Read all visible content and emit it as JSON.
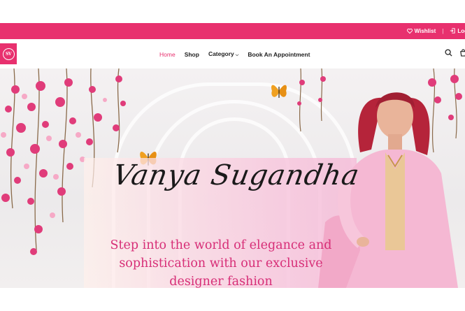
{
  "topbar": {
    "wishlist_label": "Wishlist",
    "login_label": "Log"
  },
  "header": {
    "logo_text": "SV",
    "nav": [
      {
        "label": "Home",
        "active": true
      },
      {
        "label": "Shop",
        "active": false
      },
      {
        "label": "Category",
        "active": false,
        "has_dropdown": true
      },
      {
        "label": "Book An Appointment",
        "active": false
      }
    ],
    "icons": [
      "search-icon",
      "cart-icon"
    ]
  },
  "banner": {
    "title": "Vanya Sugandha",
    "tagline_lines": [
      "Step into the world of elegance and",
      "sophistication with our exclusive",
      "designer fashion"
    ]
  },
  "colors": {
    "brand_pink": "#e8306e",
    "tagline_pink": "#d72e77"
  }
}
